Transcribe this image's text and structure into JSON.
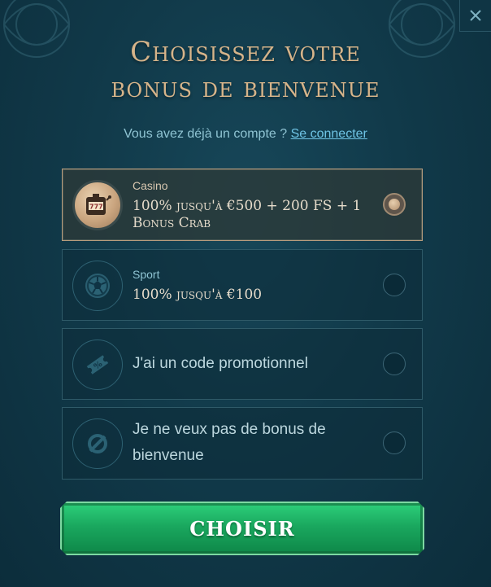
{
  "modal": {
    "title_line1": "Choisissez votre",
    "title_line2": "bonus de bienvenue",
    "account_prompt": "Vous avez déjà un compte ?",
    "login_link": "Se connecter",
    "close_icon": "close-icon"
  },
  "options": [
    {
      "label": "Casino",
      "offer": "100% jusqu'à €500 + 200 FS + 1 Bonus Crab",
      "icon": "slot-machine-icon",
      "selected": true
    },
    {
      "label": "Sport",
      "offer": "100% jusqu'à €100",
      "icon": "soccer-ball-icon",
      "selected": false
    },
    {
      "text": "J'ai un code promotionnel",
      "icon": "ticket-icon",
      "selected": false
    },
    {
      "text": "Je ne veux pas de bonus de bienvenue",
      "icon": "no-bonus-icon",
      "selected": false
    }
  ],
  "submit_label": "CHOISIR",
  "colors": {
    "background": "#113a4a",
    "title": "#d6b48a",
    "link": "#6ec3e4",
    "button": "#1aa85f"
  }
}
